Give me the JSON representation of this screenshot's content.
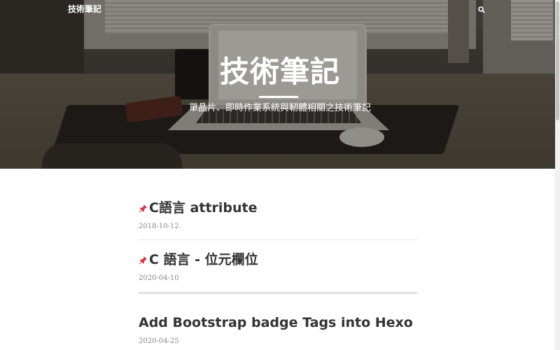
{
  "nav": {
    "brand": "技術筆記",
    "search_icon": "search-icon"
  },
  "hero": {
    "title": "技術筆記",
    "subtitle": "單晶片、即時作業系統與軔體相關之技術筆記"
  },
  "posts": [
    {
      "pinned": true,
      "title": "C語言 attribute",
      "date": "2018-10-12"
    },
    {
      "pinned": true,
      "title": "C 語言 - 位元欄位",
      "date": "2020-04-10"
    },
    {
      "pinned": false,
      "title": "Add Bootstrap badge Tags into Hexo",
      "date": "2020-04-25"
    }
  ],
  "colors": {
    "pin": "#d9303a",
    "title": "#333333",
    "date": "#888888"
  }
}
